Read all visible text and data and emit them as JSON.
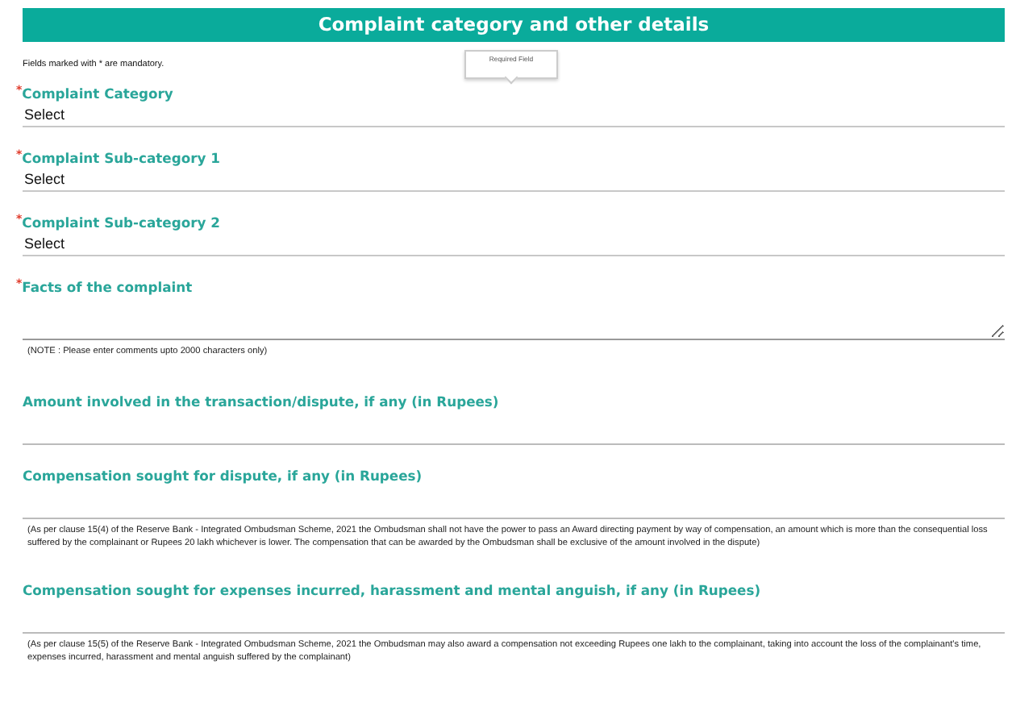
{
  "header": {
    "title": "Complaint category and other details"
  },
  "mandatory_note": "Fields marked with * are mandatory.",
  "tooltip": {
    "text": "Required Field"
  },
  "fields": [
    {
      "kind": "select",
      "asterisk": "*",
      "label": "Complaint Category",
      "value": "Select"
    },
    {
      "kind": "select",
      "asterisk": "*",
      "label": "Complaint Sub-category 1",
      "value": "Select"
    },
    {
      "kind": "select",
      "asterisk": "*",
      "label": "Complaint Sub-category 2",
      "value": "Select"
    },
    {
      "kind": "textarea",
      "asterisk": "*",
      "label": "Facts of the complaint",
      "note": "(NOTE : Please enter comments upto 2000 characters only)"
    },
    {
      "kind": "text",
      "label": "Amount involved in the transaction/dispute, if any (in Rupees)"
    },
    {
      "kind": "text",
      "label": "Compensation sought for dispute, if any (in Rupees)",
      "note": "(As per clause 15(4) of the Reserve Bank - Integrated Ombudsman Scheme, 2021 the Ombudsman shall not have the power to pass an Award directing payment by way of compensation, an amount which is more than the consequential loss suffered by the complainant or Rupees 20 lakh whichever is lower. The compensation that can be awarded by the Ombudsman shall be exclusive of the amount involved in the dispute)"
    },
    {
      "kind": "text",
      "label": "Compensation sought for expenses incurred, harassment and mental anguish, if any (in Rupees)",
      "note": "(As per clause 15(5) of the Reserve Bank - Integrated Ombudsman Scheme, 2021 the Ombudsman may also award a compensation not exceeding Rupees one lakh to the complainant, taking into account the loss of the complainant's time, expenses incurred, harassment and mental anguish suffered by the complainant)"
    }
  ]
}
